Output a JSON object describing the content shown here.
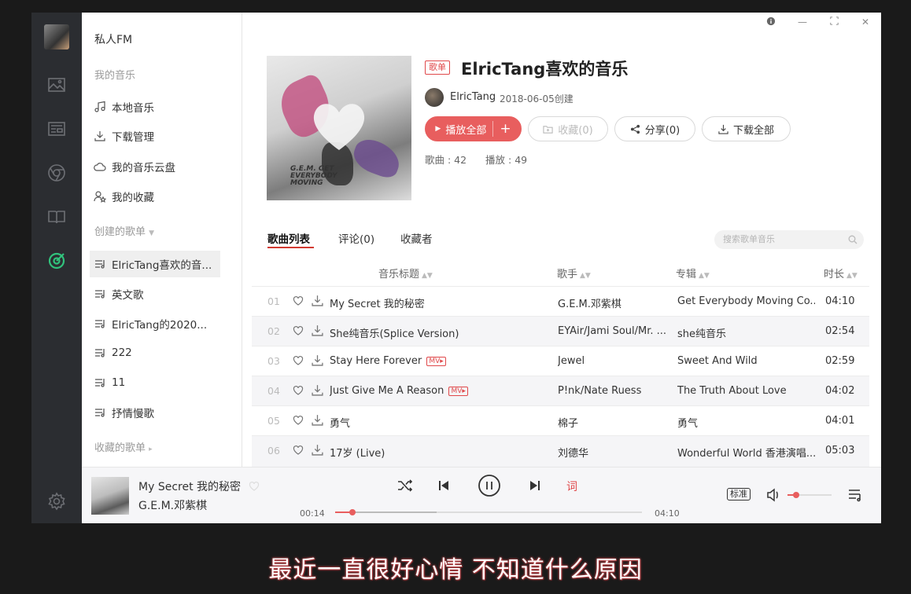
{
  "window": {
    "controls": [
      "info",
      "minimize",
      "maximize",
      "close"
    ]
  },
  "sidebar": {
    "top_item": "私人FM",
    "section_my_music": "我的音乐",
    "my_music": [
      {
        "label": "本地音乐",
        "icon": "music-note-icon"
      },
      {
        "label": "下载管理",
        "icon": "download-icon"
      },
      {
        "label": "我的音乐云盘",
        "icon": "cloud-icon"
      },
      {
        "label": "我的收藏",
        "icon": "user-star-icon"
      }
    ],
    "section_created": "创建的歌单",
    "created_playlists": [
      {
        "label": "ElricTang喜欢的音...",
        "selected": true
      },
      {
        "label": "英文歌"
      },
      {
        "label": "ElricTang的2020..."
      },
      {
        "label": "222"
      },
      {
        "label": "11"
      },
      {
        "label": "抒情慢歌"
      }
    ],
    "section_collected": "收藏的歌单"
  },
  "playlist": {
    "tag": "歌单",
    "title": "ElricTang喜欢的音乐",
    "creator": "ElricTang",
    "created": "2018-06-05创建",
    "cover_text": "G.E.M. GET EVERYBODY MOVING",
    "buttons": {
      "play_all": "播放全部",
      "collect": "收藏(0)",
      "share": "分享(0)",
      "download_all": "下载全部"
    },
    "song_count_label": "歌曲 : 42",
    "play_count_label": "播放 : 49"
  },
  "tabs": [
    {
      "label": "歌曲列表",
      "active": true
    },
    {
      "label": "评论(0)"
    },
    {
      "label": "收藏者"
    }
  ],
  "search": {
    "placeholder": "搜索歌单音乐"
  },
  "table": {
    "headers": {
      "title": "音乐标题",
      "artist": "歌手",
      "album": "专辑",
      "duration": "时长"
    },
    "rows": [
      {
        "index": "01",
        "title": "My Secret 我的秘密",
        "mv": false,
        "artist": "G.E.M.邓紫棋",
        "album": "Get Everybody Moving Co...",
        "duration": "04:10"
      },
      {
        "index": "02",
        "title": "She纯音乐(Splice Version)",
        "mv": false,
        "artist": "EYAir/Jami Soul/Mr. ...",
        "album": "she纯音乐",
        "duration": "02:54"
      },
      {
        "index": "03",
        "title": "Stay Here Forever",
        "mv": true,
        "artist": "Jewel",
        "album": "Sweet And Wild",
        "duration": "02:59"
      },
      {
        "index": "04",
        "title": "Just Give Me A Reason",
        "mv": true,
        "artist": "P!nk/Nate Ruess",
        "album": "The Truth About Love",
        "duration": "04:02"
      },
      {
        "index": "05",
        "title": "勇气",
        "mv": false,
        "artist": "棉子",
        "album": "勇气",
        "duration": "04:01"
      },
      {
        "index": "06",
        "title": "17岁 (Live)",
        "mv": false,
        "artist": "刘德华",
        "album": "Wonderful World 香港演唱...",
        "duration": "05:03"
      }
    ],
    "mv_label": "MV"
  },
  "player": {
    "title": "My Secret 我的秘密",
    "artist": "G.E.M.邓紫棋",
    "elapsed": "00:14",
    "total": "04:10",
    "progress": 0.056,
    "lyrics_button": "词",
    "quality": "标准",
    "volume": 0.2
  },
  "subtitle": "最近一直很好心情 不知道什么原因",
  "colors": {
    "accent": "#e85e5e",
    "rail": "#2b2d31",
    "active_icon": "#31c27c"
  }
}
